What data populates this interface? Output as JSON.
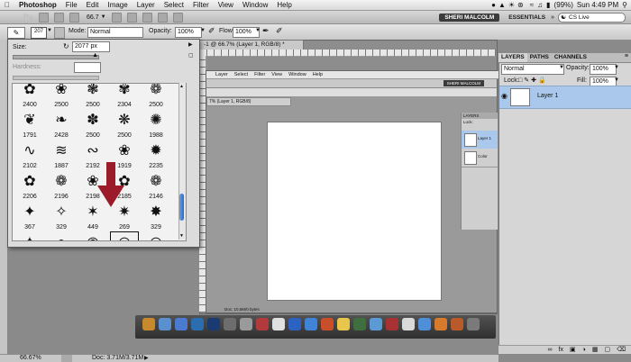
{
  "menubar": {
    "app": "Photoshop",
    "items": [
      "File",
      "Edit",
      "Image",
      "Layer",
      "Select",
      "Filter",
      "View",
      "Window",
      "Help"
    ],
    "battery": "(99%)",
    "clock": "Sun 4:49 PM"
  },
  "appbar": {
    "logo": "Ps",
    "zoom": "66.7",
    "user_button": "SHERI MALCOLM",
    "workspace_button": "ESSENTIALS",
    "cslive": "CS Live"
  },
  "options": {
    "brush_size": "207",
    "mode_label": "Mode:",
    "mode_value": "Normal",
    "opacity_label": "Opacity:",
    "opacity_value": "100%",
    "flow_label": "Flow:",
    "flow_value": "100%"
  },
  "brush_popup": {
    "size_label": "Size:",
    "size_value": "2077 px",
    "hardness_label": "Hardness:",
    "size_fraction": 0.97,
    "brushes": [
      {
        "num": "2400",
        "g": "✿"
      },
      {
        "num": "2500",
        "g": "❀"
      },
      {
        "num": "2500",
        "g": "❃"
      },
      {
        "num": "2304",
        "g": "✾"
      },
      {
        "num": "2500",
        "g": "❁"
      },
      {
        "num": "1791",
        "g": "❦"
      },
      {
        "num": "2428",
        "g": "❧"
      },
      {
        "num": "2500",
        "g": "✽"
      },
      {
        "num": "2500",
        "g": "❋"
      },
      {
        "num": "1988",
        "g": "✺"
      },
      {
        "num": "2102",
        "g": "∿"
      },
      {
        "num": "1887",
        "g": "≋"
      },
      {
        "num": "2192",
        "g": "∾"
      },
      {
        "num": "1919",
        "g": "❀"
      },
      {
        "num": "2235",
        "g": "✹"
      },
      {
        "num": "2206",
        "g": "✿"
      },
      {
        "num": "2196",
        "g": "❁"
      },
      {
        "num": "2198",
        "g": "❀"
      },
      {
        "num": "2185",
        "g": "✿"
      },
      {
        "num": "2146",
        "g": "❁"
      },
      {
        "num": "367",
        "g": "✦"
      },
      {
        "num": "329",
        "g": "✧"
      },
      {
        "num": "449",
        "g": "✶"
      },
      {
        "num": "269",
        "g": "✷"
      },
      {
        "num": "329",
        "g": "✸"
      },
      {
        "num": "367",
        "g": "✦"
      },
      {
        "num": "177",
        "g": "●"
      },
      {
        "num": "197",
        "g": "◉"
      },
      {
        "num": "2077",
        "g": "◎"
      },
      {
        "num": "2077",
        "g": "◎"
      }
    ]
  },
  "document": {
    "tab_title": "-1 @ 66.7% (Layer 1, RGB/8) *",
    "status_zoom": "66.67%",
    "status_doc": "Doc: 3.71M/3.71M"
  },
  "inner_screenshot": {
    "menu": [
      "Layer",
      "Select",
      "Filter",
      "View",
      "Window",
      "Help"
    ],
    "tab": "7% (Layer 1, RGB/8)",
    "user": "SHERI MALCOLM",
    "layer_name": "Layer 1",
    "color_label": "Color",
    "layers_tab": "LAYERS",
    "lock_label": "Lock:",
    "status_doc": "Doc: 10.5M/0 bytes",
    "status_zoom": "229"
  },
  "layers_panel": {
    "tabs": [
      "LAYERS",
      "PATHS",
      "CHANNELS"
    ],
    "blend_mode": "Normal",
    "opacity_label": "Opacity:",
    "opacity_value": "100%",
    "lock_label": "Lock:",
    "fill_label": "Fill:",
    "fill_value": "100%",
    "layer_name": "Layer 1",
    "bottom_icons": [
      "link",
      "fx",
      "mask",
      "adjust",
      "folder",
      "new",
      "trash"
    ]
  },
  "colors": {
    "accent_arrow": "#9b1b2a",
    "selection_blue": "#a9c8ec"
  }
}
